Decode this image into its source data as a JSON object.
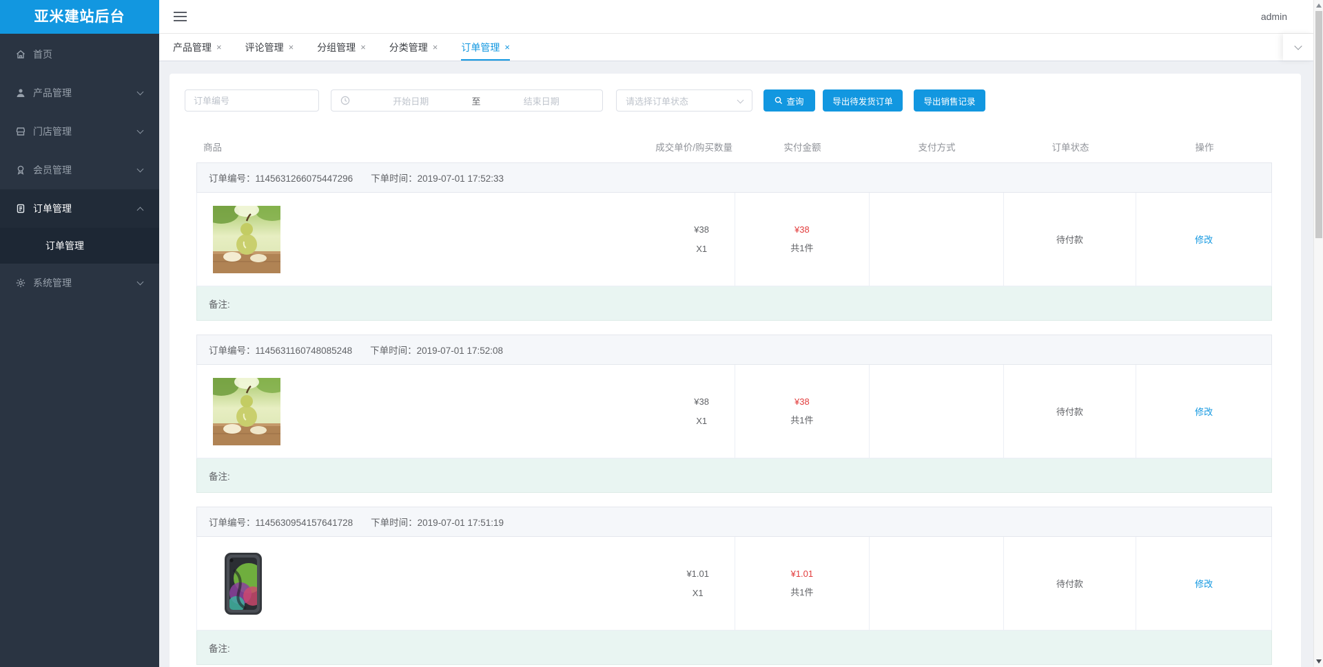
{
  "app": {
    "title": "亚米建站后台"
  },
  "topbar": {
    "user": "admin"
  },
  "ui": {
    "close_glyph": "×"
  },
  "sidebar": {
    "items": [
      {
        "label": "首页",
        "icon": "home-icon"
      },
      {
        "label": "产品管理",
        "icon": "user-icon"
      },
      {
        "label": "门店管理",
        "icon": "store-icon"
      },
      {
        "label": "会员管理",
        "icon": "member-icon"
      },
      {
        "label": "订单管理",
        "icon": "order-icon",
        "expanded": true,
        "children": [
          {
            "label": "订单管理",
            "active": true
          }
        ]
      },
      {
        "label": "系统管理",
        "icon": "gear-icon"
      }
    ]
  },
  "tabs": [
    {
      "label": "产品管理"
    },
    {
      "label": "评论管理"
    },
    {
      "label": "分组管理"
    },
    {
      "label": "分类管理"
    },
    {
      "label": "订单管理",
      "active": true
    }
  ],
  "filters": {
    "order_no_placeholder": "订单编号",
    "start_date_placeholder": "开始日期",
    "date_separator": "至",
    "end_date_placeholder": "结束日期",
    "status_placeholder": "请选择订单状态",
    "search_label": "查询",
    "export_pending_label": "导出待发货订单",
    "export_sales_label": "导出销售记录"
  },
  "table": {
    "headers": {
      "product": "商品",
      "unit_price": "成交单价/购买数量",
      "paid": "实付金额",
      "payment": "支付方式",
      "status": "订单状态",
      "action": "操作"
    }
  },
  "orders": [
    {
      "order_no_label": "订单编号：",
      "order_no": "1145631266075447296",
      "time_label": "下单时间：",
      "time": "2019-07-01 17:52:33",
      "product_image": "pear-photo",
      "unit_price": "¥38",
      "quantity": "X1",
      "paid": "¥38",
      "total_items": "共1件",
      "payment": "",
      "status": "待付款",
      "action": "修改",
      "remark_label": "备注:",
      "remark": ""
    },
    {
      "order_no_label": "订单编号：",
      "order_no": "1145631160748085248",
      "time_label": "下单时间：",
      "time": "2019-07-01 17:52:08",
      "product_image": "pear-photo",
      "unit_price": "¥38",
      "quantity": "X1",
      "paid": "¥38",
      "total_items": "共1件",
      "payment": "",
      "status": "待付款",
      "action": "修改",
      "remark_label": "备注:",
      "remark": ""
    },
    {
      "order_no_label": "订单编号：",
      "order_no": "1145630954157641728",
      "time_label": "下单时间：",
      "time": "2019-07-01 17:51:19",
      "product_image": "phone-photo",
      "unit_price": "¥1.01",
      "quantity": "X1",
      "paid": "¥1.01",
      "total_items": "共1件",
      "payment": "",
      "status": "待付款",
      "action": "修改",
      "remark_label": "备注:",
      "remark": ""
    }
  ],
  "colors": {
    "accent": "#1297e0",
    "danger": "#e23c3c",
    "sidebar_bg": "#2a3442",
    "sidebar_active_bg": "#212b38",
    "band_bg": "#f5f7fa",
    "remark_bg": "#e9f5f2"
  }
}
